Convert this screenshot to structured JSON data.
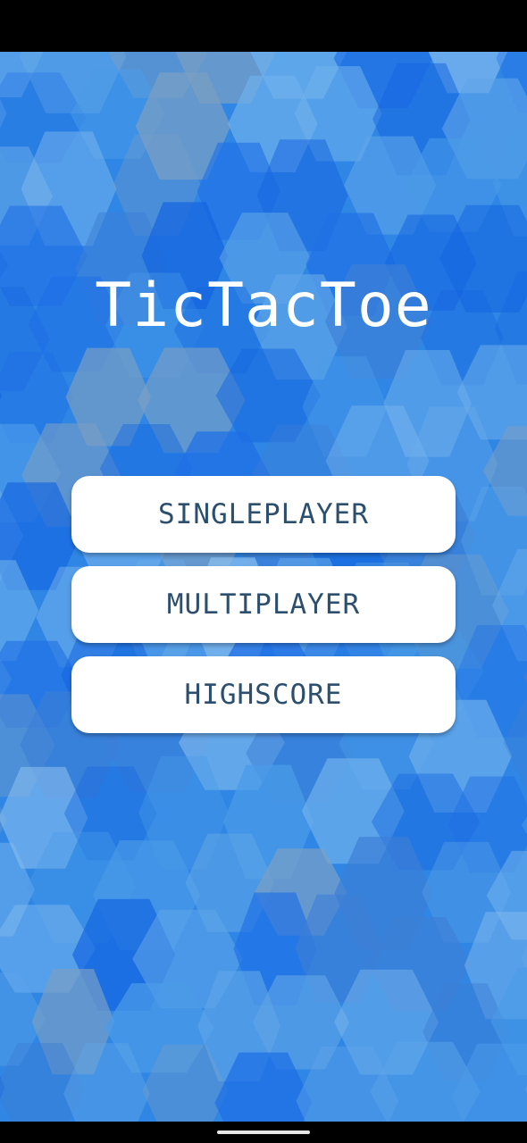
{
  "app": {
    "title": "TicTacToe"
  },
  "menu": {
    "singleplayer_label": "SINGLEPLAYER",
    "multiplayer_label": "MULTIPLAYER",
    "highscore_label": "HIGHSCORE"
  },
  "colors": {
    "background_blue": "#2f86e4",
    "button_bg": "#ffffff",
    "button_text": "#2c4f6e",
    "title_text": "#ffffff"
  }
}
